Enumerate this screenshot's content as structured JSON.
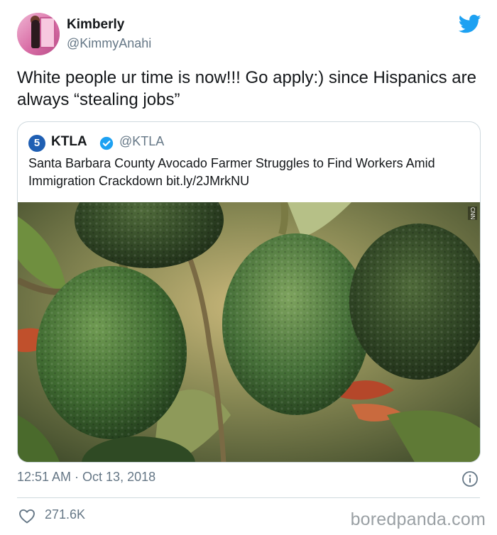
{
  "author": {
    "name": "Kimberly",
    "handle": "@KimmyAnahi"
  },
  "tweet": {
    "text": "White people ur time is now!!! Go apply:) since Hispanics are always “stealing jobs”",
    "timestamp": "12:51 AM · Oct 13, 2018",
    "likes": "271.6K"
  },
  "quoted_tweet": {
    "logo_text": "5",
    "name": "KTLA",
    "handle": "@KTLA",
    "text": "Santa Barbara County Avocado Farmer Struggles to Find Workers Amid Immigration Crackdown bit.ly/2JMrkNU",
    "image_tag": "CNN"
  },
  "watermark": "boredpanda.com",
  "colors": {
    "twitter_blue": "#1da1f2",
    "text_primary": "#14171a",
    "text_secondary": "#657786",
    "border": "#cfd9de"
  },
  "icons": [
    "twitter-bird-icon",
    "verified-badge-icon",
    "info-icon",
    "heart-icon"
  ]
}
